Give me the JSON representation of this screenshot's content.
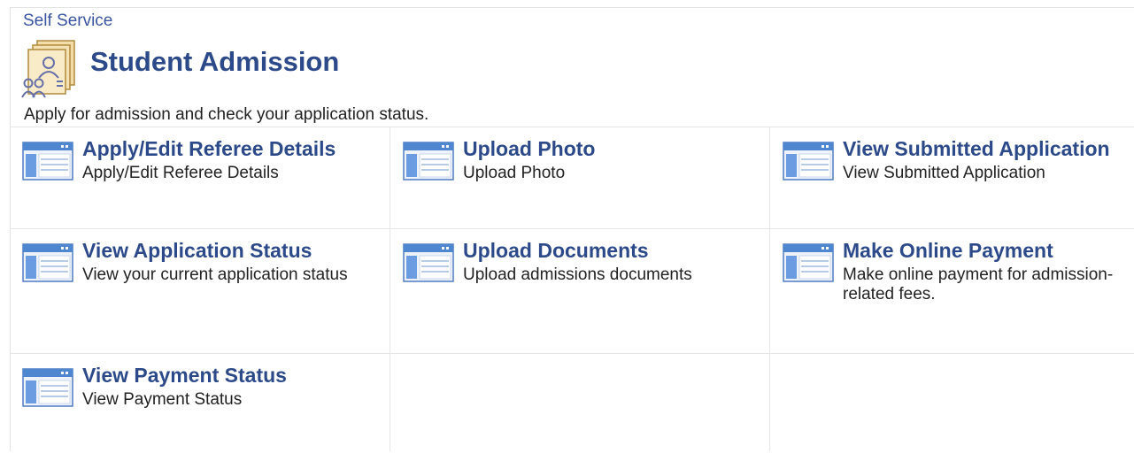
{
  "header": {
    "breadcrumb": "Self Service",
    "title": "Student Admission",
    "subtitle": "Apply for admission and check your application status.",
    "icon": "student-admission-icon"
  },
  "colors": {
    "title": "#2c4a8a",
    "link": "#2c4a8a",
    "breadcrumb": "#3a55a0",
    "text": "#222222",
    "border": "#e6e6e6"
  },
  "tiles": [
    {
      "title": "Apply/Edit Referee Details",
      "description": "Apply/Edit Referee Details",
      "icon": "page-icon"
    },
    {
      "title": "Upload Photo",
      "description": "Upload Photo",
      "icon": "page-icon"
    },
    {
      "title": "View Submitted Application",
      "description": "View Submitted Application",
      "icon": "page-icon"
    },
    {
      "title": "View Application Status",
      "description": "View your current application status",
      "icon": "page-icon"
    },
    {
      "title": "Upload Documents",
      "description": "Upload admissions documents",
      "icon": "page-icon"
    },
    {
      "title": "Make Online Payment",
      "description": "Make online payment for admission-related fees.",
      "icon": "page-icon"
    },
    {
      "title": "View Payment Status",
      "description": "View Payment Status",
      "icon": "page-icon"
    }
  ]
}
